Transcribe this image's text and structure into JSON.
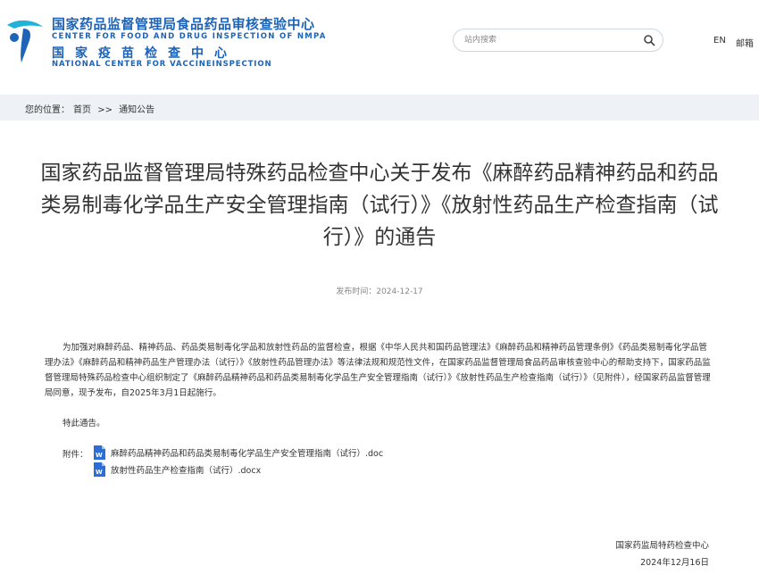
{
  "header": {
    "org_name_cn": "国家药品监督管理局食品药品审核查验中心",
    "org_name_en": "CENTER FOR FOOD AND DRUG INSPECTION OF NMPA",
    "org_name_cn2": "国家疫苗检查中心",
    "org_name_en2": "NATIONAL CENTER FOR VACCINEINSPECTION",
    "search_placeholder": "站内搜索",
    "nav_en": "EN",
    "nav_mail": "邮箱"
  },
  "breadcrumb": {
    "prefix": "您的位置：",
    "home": "首页",
    "separator": ">>",
    "current": "通知公告"
  },
  "article": {
    "title": "国家药品监督管理局特殊药品检查中心关于发布《麻醉药品精神药品和药品类易制毒化学品生产安全管理指南（试行）》《放射性药品生产检查指南（试行）》的通告",
    "date_label": "发布时间：",
    "date": "2024-12-17",
    "body": "为加强对麻醉药品、精神药品、药品类易制毒化学品和放射性药品的监督检查，根据《中华人民共和国药品管理法》《麻醉药品和精神药品管理条例》《药品类易制毒化学品管理办法》《麻醉药品和精神药品生产管理办法（试行）》《放射性药品管理办法》等法律法规和规范性文件，在国家药品监督管理局食品药品审核查验中心的帮助支持下，国家药品监督管理局特殊药品检查中心组织制定了《麻醉药品精神药品和药品类易制毒化学品生产安全管理指南（试行）》《放射性药品生产检查指南（试行）》（见附件），经国家药品监督管理局同意，现予发布，自2025年3月1日起施行。",
    "closing": "特此通告。",
    "attachments_label": "附件：",
    "attachments": [
      {
        "name": "麻醉药品精神药品和药品类易制毒化学品生产安全管理指南（试行）.doc",
        "icon": "word-doc-icon"
      },
      {
        "name": "放射性药品生产检查指南（试行）.docx",
        "icon": "word-doc-icon"
      }
    ],
    "signature_org": "国家药监局特药检查中心",
    "signature_date": "2024年12月16日"
  },
  "colors": {
    "brand_blue": "#1d63b8",
    "brand_cyan": "#1fb3d8",
    "breadcrumb_bg": "#eef2f6",
    "word_blue": "#2b6fd6"
  }
}
